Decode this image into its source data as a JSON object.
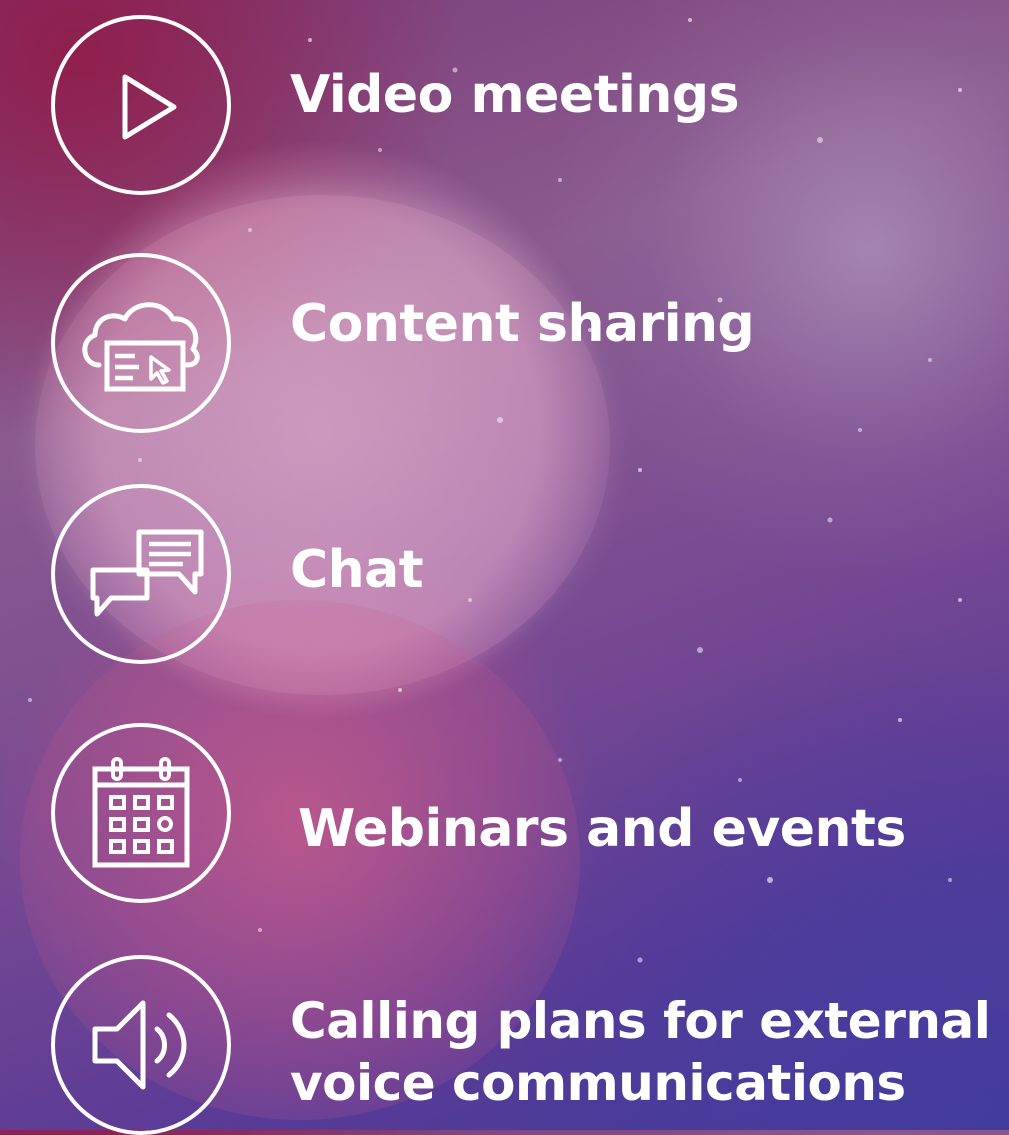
{
  "features": [
    {
      "label": "Video meetings",
      "icon": "play-icon"
    },
    {
      "label": "Content sharing",
      "icon": "cloud-screen-icon"
    },
    {
      "label": "Chat",
      "icon": "chat-bubbles-icon"
    },
    {
      "label": "Webinars and events",
      "icon": "calendar-icon"
    },
    {
      "label_line1": "Calling plans for external",
      "label_line2": "voice communications",
      "icon": "speaker-icon"
    }
  ],
  "colors": {
    "text": "#ffffff",
    "icon_stroke": "#ffffff",
    "background_main": "#7a4a92",
    "background_accent": "#3e3b9a"
  }
}
